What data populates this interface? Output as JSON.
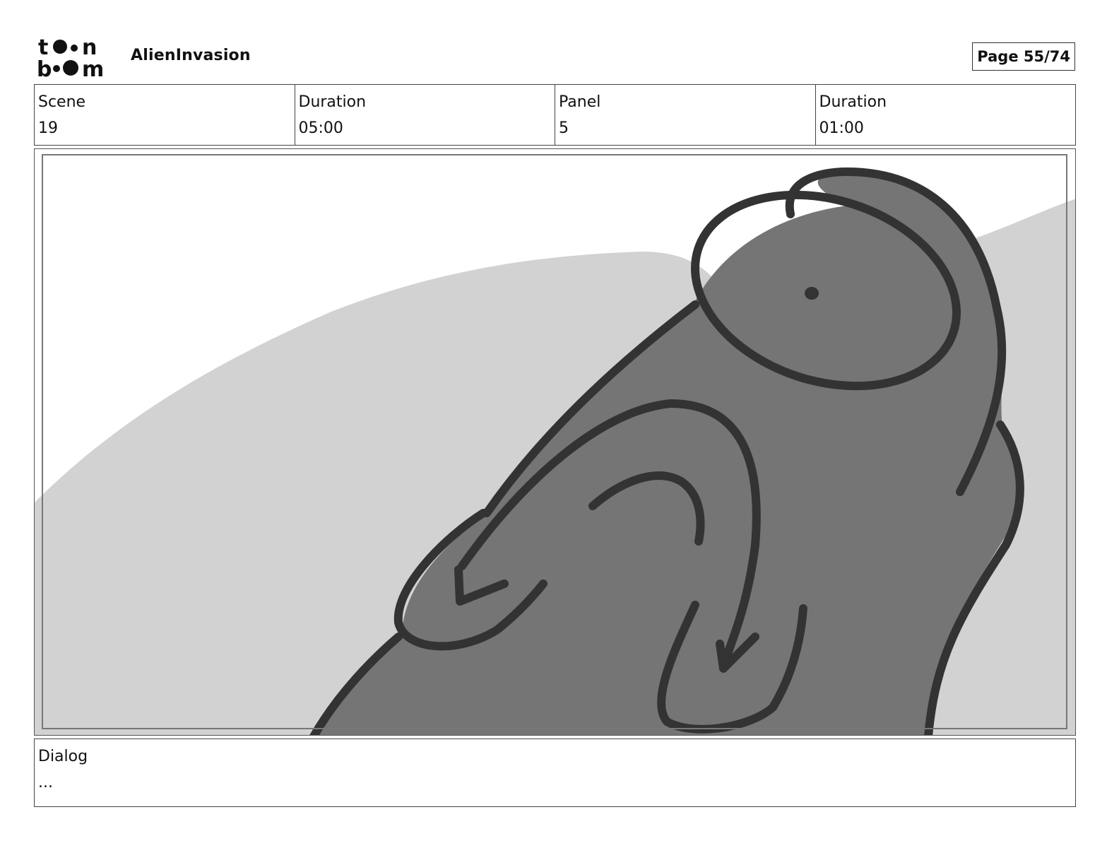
{
  "header": {
    "logo_top": "t•n",
    "logo_bottom": "b•m",
    "project_title": "AlienInvasion",
    "page_indicator": "Page 55/74"
  },
  "info": [
    {
      "label": "Scene",
      "value": "19"
    },
    {
      "label": "Duration",
      "value": "05:00"
    },
    {
      "label": "Panel",
      "value": "5"
    },
    {
      "label": "Duration",
      "value": "01:00"
    }
  ],
  "dialog": {
    "label": "Dialog",
    "text": "..."
  },
  "colors": {
    "background_hill": "#d2d2d2",
    "creature_fill": "#757575",
    "line_art": "#333333"
  }
}
